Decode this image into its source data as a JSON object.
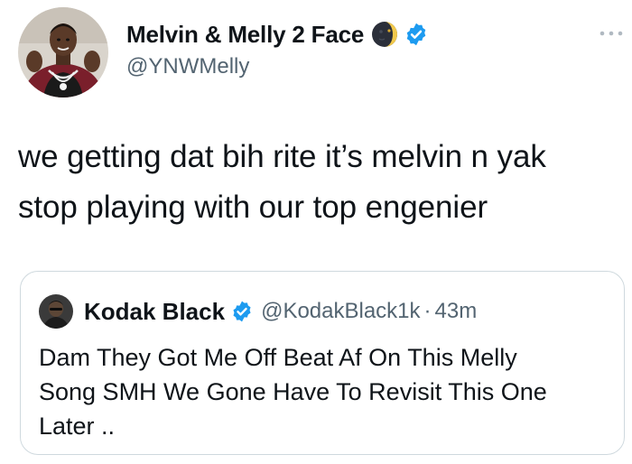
{
  "author": {
    "display_name": "Melvin & Melly 2 Face",
    "handle": "@YNWMelly",
    "emoji_icon": "new-moon-face-icon",
    "verified_icon": "verified-badge-icon",
    "verified_color": "#1d9bf0"
  },
  "menu": {
    "icon": "more-horizontal-icon"
  },
  "tweet": {
    "text": "we getting dat bih rite it’s melvin n yak\nstop playing with our top engenier"
  },
  "quote": {
    "display_name": "Kodak Black",
    "handle": "@KodakBlack1k",
    "separator": "·",
    "time": "43m",
    "text": "Dam They Got Me Off Beat Af On This Melly\nSong SMH We Gone Have To Revisit This One\nLater ..",
    "verified_icon": "verified-badge-icon"
  },
  "colors": {
    "text": "#0f1419",
    "secondary": "#536471",
    "border": "#cfd9de",
    "accent": "#1d9bf0"
  }
}
